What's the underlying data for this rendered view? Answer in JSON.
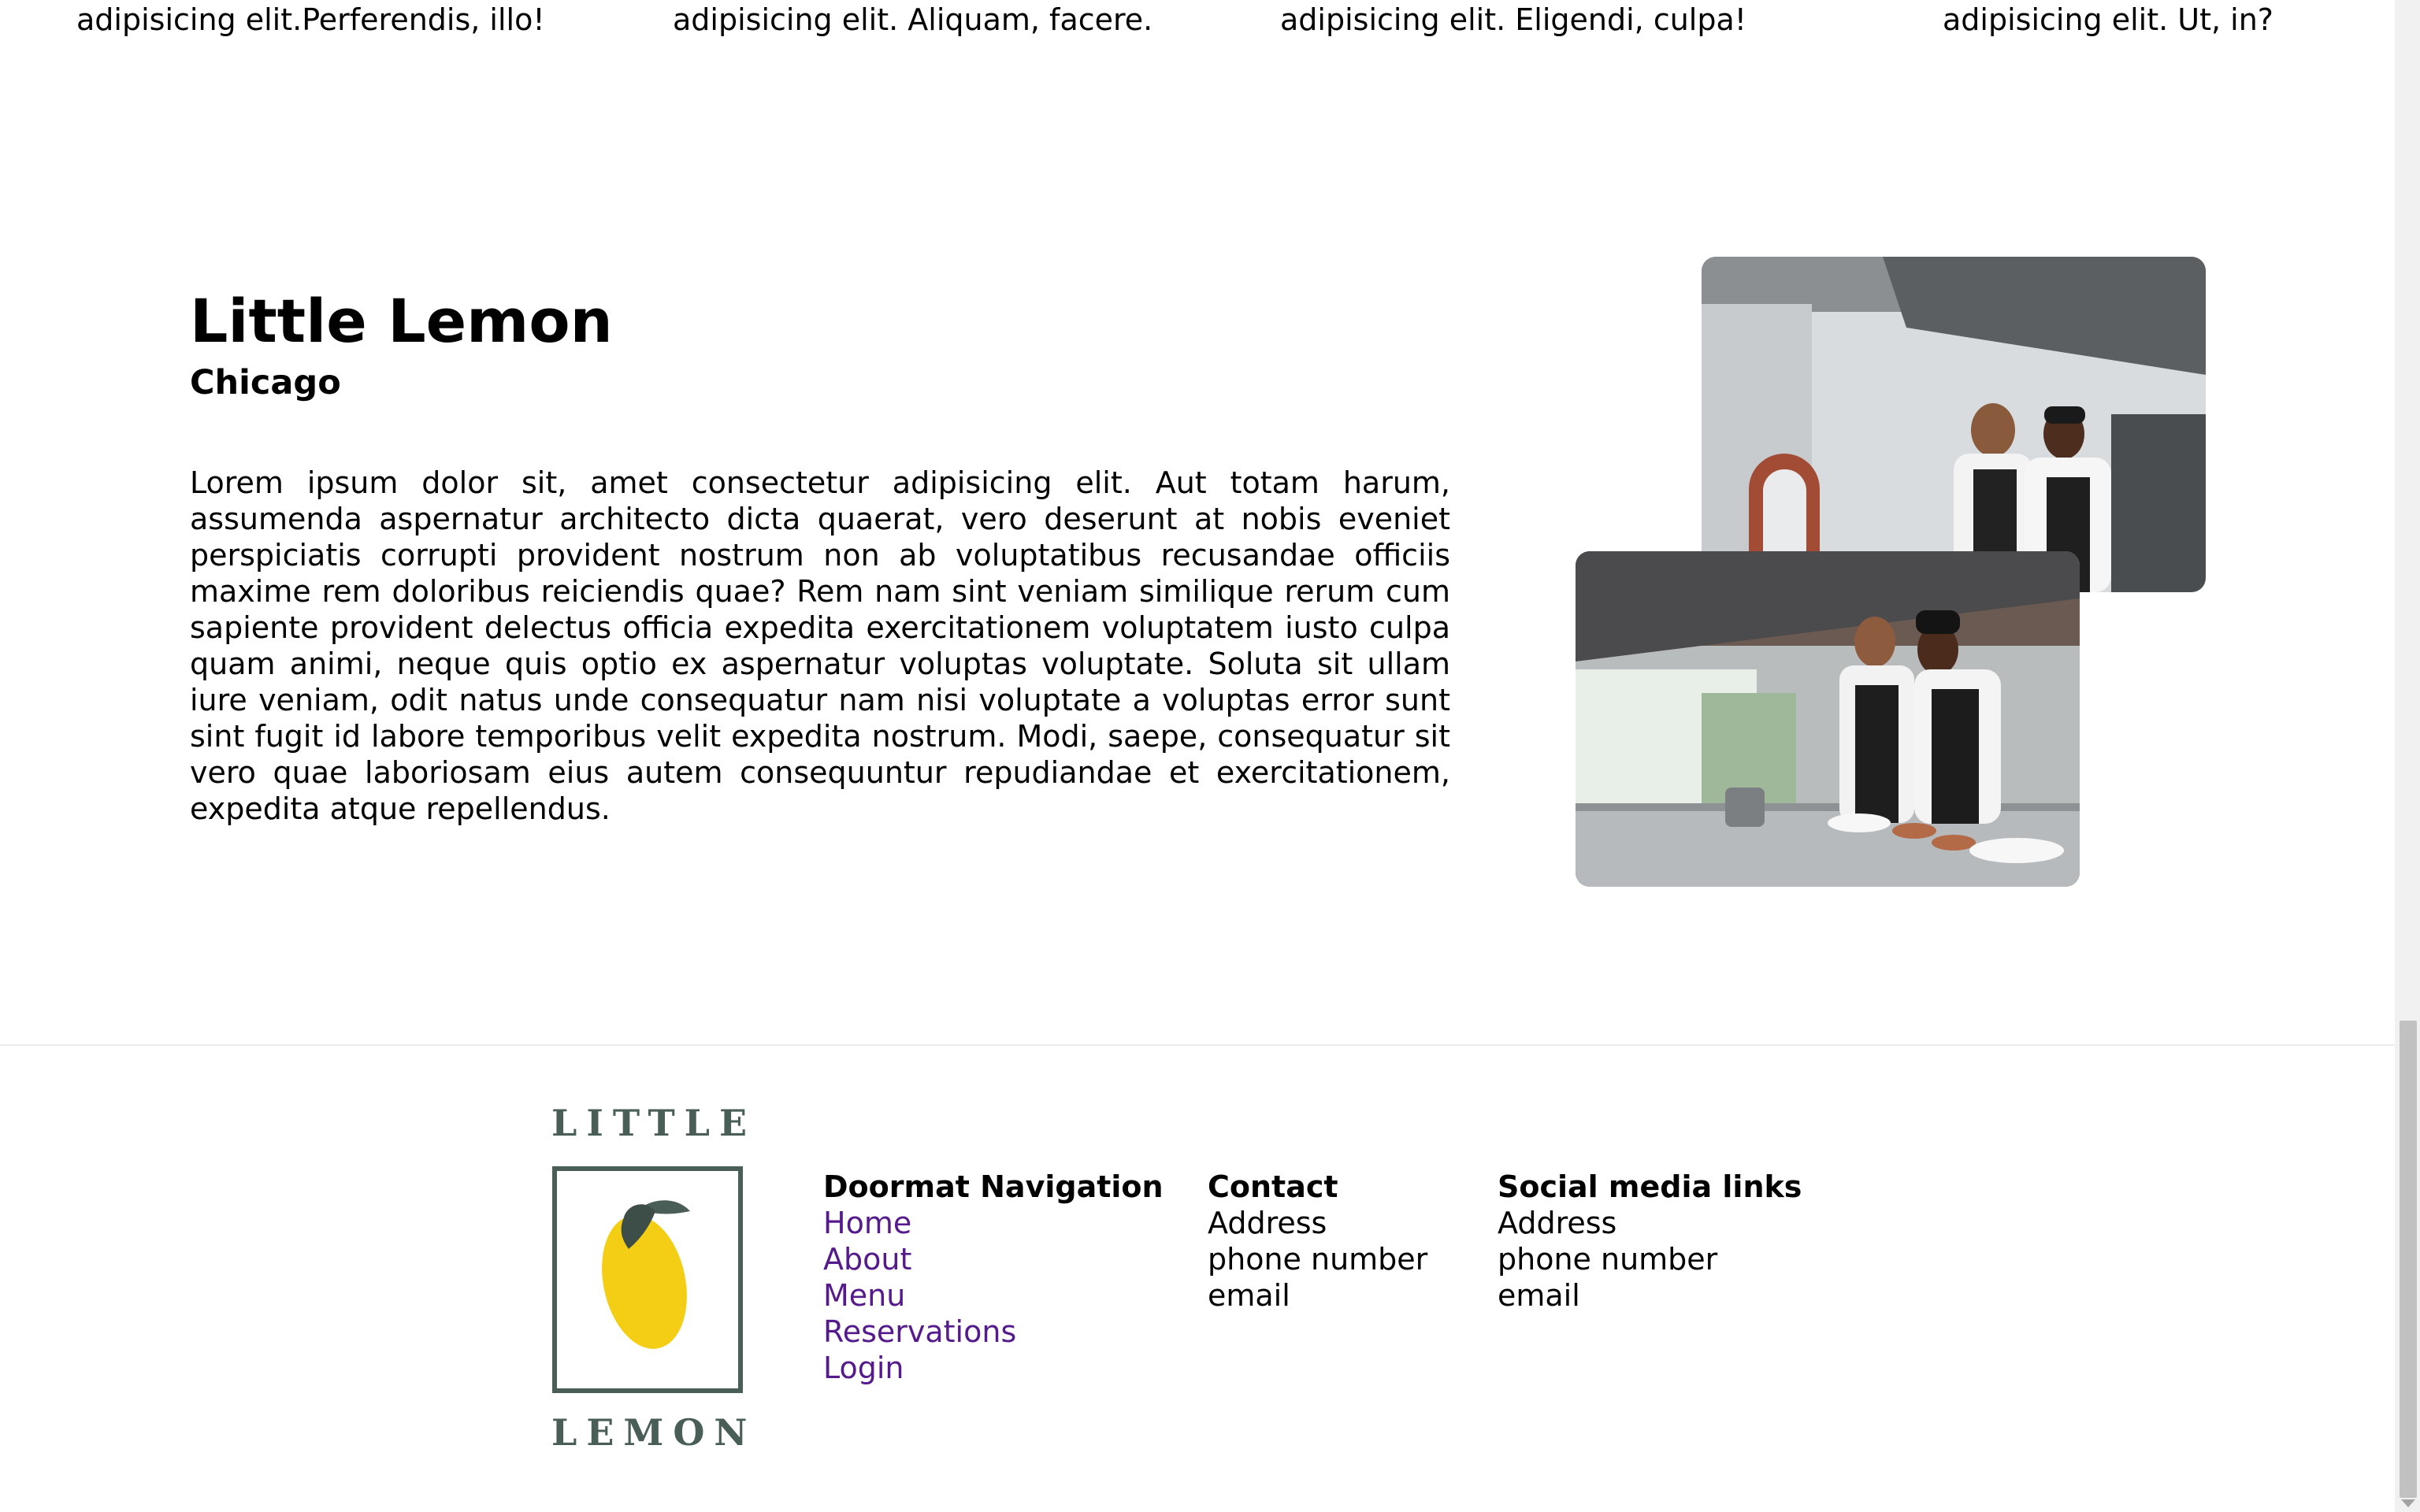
{
  "testimonials_strip": [
    "adipisicing elit.Perferendis, illo!",
    "adipisicing elit. Aliquam, facere.",
    "adipisicing elit. Eligendi, culpa!",
    "adipisicing elit. Ut, in?"
  ],
  "about": {
    "title": "Little Lemon",
    "city": "Chicago",
    "body": "Lorem ipsum dolor sit, amet consectetur adipisicing elit. Aut totam harum, assumenda aspernatur architecto dicta quaerat, vero deserunt at nobis eveniet perspiciatis corrupti provident nostrum non ab voluptatibus recusandae officiis maxime rem doloribus reiciendis quae? Rem nam sint veniam similique rerum cum sapiente provident delectus officia expedita exercitationem voluptatem iusto culpa quam animi, neque quis optio ex aspernatur voluptas voluptate. Soluta sit ullam iure veniam, odit natus unde consequatur nam nisi voluptate a voluptas error sunt sint fugit id labore temporibus velit expedita nostrum. Modi, saepe, consequatur sit vero quae laboriosam eius autem consequuntur repudiandae et exercitationem, expedita atque repellendus."
  },
  "footer": {
    "logo_top": "LITTLE",
    "logo_bottom": "LEMON",
    "nav": {
      "heading": "Doormat Navigation",
      "links": [
        "Home",
        "About",
        "Menu",
        "Reservations",
        "Login"
      ]
    },
    "contact": {
      "heading": "Contact",
      "lines": [
        "Address",
        "phone number",
        "email"
      ]
    },
    "social": {
      "heading": "Social media links",
      "lines": [
        "Address",
        "phone number",
        "email"
      ]
    }
  },
  "colors": {
    "brand_green": "#495e57",
    "brand_yellow": "#f4ce14",
    "visited_link": "#551a8b"
  }
}
